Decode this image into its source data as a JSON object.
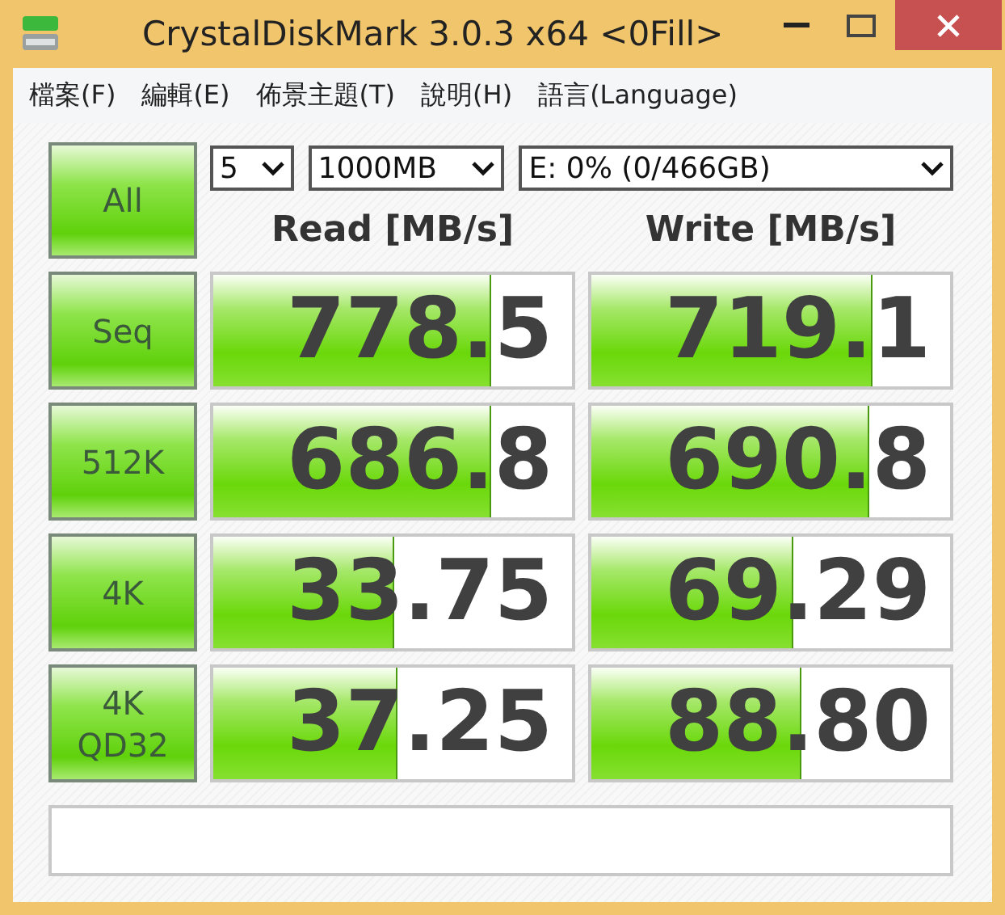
{
  "window": {
    "title": "CrystalDiskMark 3.0.3 x64 <0Fill>"
  },
  "menu": [
    "檔案(F)",
    "編輯(E)",
    "佈景主題(T)",
    "說明(H)",
    "語言(Language)"
  ],
  "all_button": "All",
  "settings": {
    "runs": "5",
    "size": "1000MB",
    "drive": "E: 0% (0/466GB)"
  },
  "columns": [
    "Read [MB/s]",
    "Write [MB/s]"
  ],
  "tests": [
    {
      "label": "Seq",
      "read": {
        "value": "778.5",
        "level": 0.77
      },
      "write": {
        "value": "719.1",
        "level": 0.78
      }
    },
    {
      "label": "512K",
      "read": {
        "value": "686.8",
        "level": 0.77
      },
      "write": {
        "value": "690.8",
        "level": 0.77
      }
    },
    {
      "label": "4K",
      "read": {
        "value": "33.75",
        "level": 0.5
      },
      "write": {
        "value": "69.29",
        "level": 0.56
      }
    },
    {
      "label": "4K\nQD32",
      "read": {
        "value": "37.25",
        "level": 0.51
      },
      "write": {
        "value": "88.80",
        "level": 0.58
      }
    }
  ]
}
